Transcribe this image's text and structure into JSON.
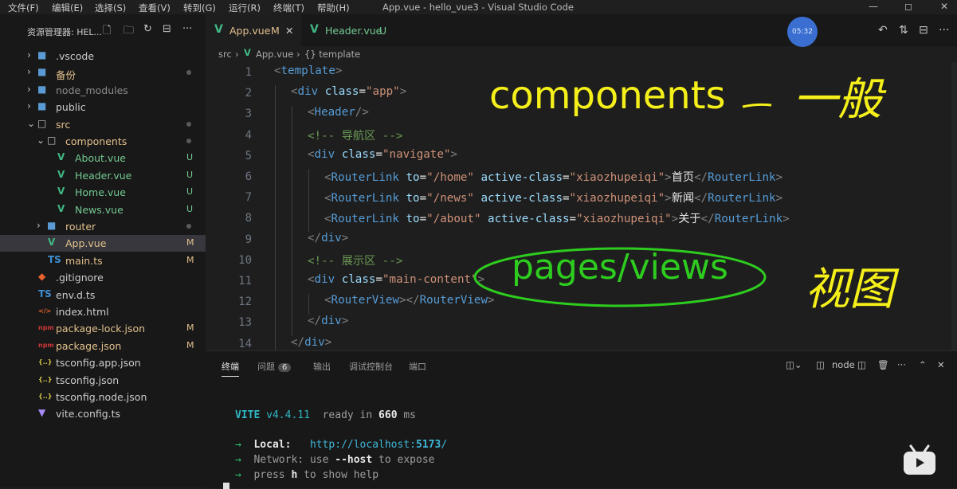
{
  "menubar": {
    "items": [
      "文件(F)",
      "编辑(E)",
      "选择(S)",
      "查看(V)",
      "转到(G)",
      "运行(R)",
      "终端(T)",
      "帮助(H)"
    ],
    "window_title": "App.vue - hello_vue3 - Visual Studio Code"
  },
  "sidebar": {
    "title": "资源管理器: HEL...",
    "actions": [
      "new-file-icon",
      "new-folder-icon",
      "refresh-icon",
      "collapse-icon",
      "more-icon"
    ],
    "items": [
      {
        "label": ".vscode",
        "kind": "folder",
        "indent": 0,
        "status": ""
      },
      {
        "label": "备份",
        "kind": "folder",
        "indent": 0,
        "status": "dot"
      },
      {
        "label": "node_modules",
        "kind": "folder",
        "indent": 0,
        "status": ""
      },
      {
        "label": "public",
        "kind": "folder",
        "indent": 0,
        "status": ""
      },
      {
        "label": "src",
        "kind": "folder-open",
        "indent": 0,
        "status": "dot"
      },
      {
        "label": "components",
        "kind": "folder-open",
        "indent": 1,
        "status": "dot"
      },
      {
        "label": "About.vue",
        "kind": "vue",
        "indent": 2,
        "status": "U"
      },
      {
        "label": "Header.vue",
        "kind": "vue",
        "indent": 2,
        "status": "U"
      },
      {
        "label": "Home.vue",
        "kind": "vue",
        "indent": 2,
        "status": "U"
      },
      {
        "label": "News.vue",
        "kind": "vue",
        "indent": 2,
        "status": "U"
      },
      {
        "label": "router",
        "kind": "folder",
        "indent": 1,
        "status": "dot"
      },
      {
        "label": "App.vue",
        "kind": "vue",
        "indent": 1,
        "status": "M"
      },
      {
        "label": "main.ts",
        "kind": "ts",
        "indent": 1,
        "status": "M"
      },
      {
        "label": ".gitignore",
        "kind": "git",
        "indent": 0,
        "status": ""
      },
      {
        "label": "env.d.ts",
        "kind": "ts",
        "indent": 0,
        "status": ""
      },
      {
        "label": "index.html",
        "kind": "html",
        "indent": 0,
        "status": ""
      },
      {
        "label": "package-lock.json",
        "kind": "npm",
        "indent": 0,
        "status": "M"
      },
      {
        "label": "package.json",
        "kind": "npm",
        "indent": 0,
        "status": "M"
      },
      {
        "label": "tsconfig.app.json",
        "kind": "json",
        "indent": 0,
        "status": ""
      },
      {
        "label": "tsconfig.json",
        "kind": "json",
        "indent": 0,
        "status": ""
      },
      {
        "label": "tsconfig.node.json",
        "kind": "json",
        "indent": 0,
        "status": ""
      },
      {
        "label": "vite.config.ts",
        "kind": "vite",
        "indent": 0,
        "status": ""
      }
    ],
    "selected": "App.vue"
  },
  "tabs": [
    {
      "label": "App.vue",
      "status": "M",
      "active": true
    },
    {
      "label": "Header.vue",
      "status": "U",
      "active": false
    }
  ],
  "timer": "05:32",
  "breadcrumb": [
    "src",
    "App.vue",
    "{} template"
  ],
  "editor": {
    "lines": [
      {
        "n": "1",
        "indent": 0,
        "tokens": [
          [
            "p",
            "<"
          ],
          [
            "t",
            "template"
          ],
          [
            "p",
            ">"
          ]
        ]
      },
      {
        "n": "2",
        "indent": 1,
        "tokens": [
          [
            "p",
            "<"
          ],
          [
            "t",
            "div"
          ],
          [
            "x",
            " "
          ],
          [
            "a",
            "class"
          ],
          [
            "x",
            "="
          ],
          [
            "s",
            "\"app\""
          ],
          [
            "p",
            ">"
          ]
        ]
      },
      {
        "n": "3",
        "indent": 2,
        "tokens": [
          [
            "p",
            "<"
          ],
          [
            "t",
            "Header"
          ],
          [
            "p",
            "/>"
          ]
        ]
      },
      {
        "n": "4",
        "indent": 2,
        "tokens": [
          [
            "c",
            "<!-- 导航区 -->"
          ]
        ]
      },
      {
        "n": "5",
        "indent": 2,
        "tokens": [
          [
            "p",
            "<"
          ],
          [
            "t",
            "div"
          ],
          [
            "x",
            " "
          ],
          [
            "a",
            "class"
          ],
          [
            "x",
            "="
          ],
          [
            "s",
            "\"navigate\""
          ],
          [
            "p",
            ">"
          ]
        ]
      },
      {
        "n": "6",
        "indent": 3,
        "tokens": [
          [
            "p",
            "<"
          ],
          [
            "t",
            "RouterLink"
          ],
          [
            "x",
            " "
          ],
          [
            "a",
            "to"
          ],
          [
            "x",
            "="
          ],
          [
            "s",
            "\"/home\""
          ],
          [
            "x",
            " "
          ],
          [
            "a",
            "active-class"
          ],
          [
            "x",
            "="
          ],
          [
            "s",
            "\"xiaozhupeiqi\""
          ],
          [
            "p",
            ">"
          ],
          [
            "x",
            "首页"
          ],
          [
            "p",
            "</"
          ],
          [
            "t",
            "RouterLink"
          ],
          [
            "p",
            ">"
          ]
        ]
      },
      {
        "n": "7",
        "indent": 3,
        "tokens": [
          [
            "p",
            "<"
          ],
          [
            "t",
            "RouterLink"
          ],
          [
            "x",
            " "
          ],
          [
            "a",
            "to"
          ],
          [
            "x",
            "="
          ],
          [
            "s",
            "\"/news\""
          ],
          [
            "x",
            " "
          ],
          [
            "a",
            "active-class"
          ],
          [
            "x",
            "="
          ],
          [
            "s",
            "\"xiaozhupeiqi\""
          ],
          [
            "p",
            ">"
          ],
          [
            "x",
            "新闻"
          ],
          [
            "p",
            "</"
          ],
          [
            "t",
            "RouterLink"
          ],
          [
            "p",
            ">"
          ]
        ]
      },
      {
        "n": "8",
        "indent": 3,
        "tokens": [
          [
            "p",
            "<"
          ],
          [
            "t",
            "RouterLink"
          ],
          [
            "x",
            " "
          ],
          [
            "a",
            "to"
          ],
          [
            "x",
            "="
          ],
          [
            "s",
            "\"/about\""
          ],
          [
            "x",
            " "
          ],
          [
            "a",
            "active-class"
          ],
          [
            "x",
            "="
          ],
          [
            "s",
            "\"xiaozhupeiqi\""
          ],
          [
            "p",
            ">"
          ],
          [
            "x",
            "关于"
          ],
          [
            "p",
            "</"
          ],
          [
            "t",
            "RouterLink"
          ],
          [
            "p",
            ">"
          ]
        ]
      },
      {
        "n": "9",
        "indent": 2,
        "tokens": [
          [
            "p",
            "</"
          ],
          [
            "t",
            "div"
          ],
          [
            "p",
            ">"
          ]
        ]
      },
      {
        "n": "10",
        "indent": 2,
        "tokens": [
          [
            "c",
            "<!-- 展示区 -->"
          ]
        ]
      },
      {
        "n": "11",
        "indent": 2,
        "tokens": [
          [
            "p",
            "<"
          ],
          [
            "t",
            "div"
          ],
          [
            "x",
            " "
          ],
          [
            "a",
            "class"
          ],
          [
            "x",
            "="
          ],
          [
            "s",
            "\"main-content\""
          ],
          [
            "p",
            ">"
          ]
        ]
      },
      {
        "n": "12",
        "indent": 3,
        "tokens": [
          [
            "p",
            "<"
          ],
          [
            "t",
            "RouterView"
          ],
          [
            "p",
            "></"
          ],
          [
            "t",
            "RouterView"
          ],
          [
            "p",
            ">"
          ]
        ]
      },
      {
        "n": "13",
        "indent": 2,
        "tokens": [
          [
            "p",
            "</"
          ],
          [
            "t",
            "div"
          ],
          [
            "p",
            ">"
          ]
        ]
      },
      {
        "n": "14",
        "indent": 1,
        "tokens": [
          [
            "p",
            "</"
          ],
          [
            "t",
            "div"
          ],
          [
            "p",
            ">"
          ]
        ]
      }
    ]
  },
  "annotations": {
    "components": "components",
    "components_note": "一般",
    "pages": "pages/views",
    "pages_note": "视图"
  },
  "panel": {
    "tabs": [
      "终端",
      "问题",
      "输出",
      "调试控制台",
      "端口"
    ],
    "problems_count": "6",
    "shell": "node",
    "terminal": {
      "vite_name": "VITE",
      "vite_version": "v4.4.11",
      "ready_text": "ready in",
      "ready_ms": "660",
      "ready_unit": "ms",
      "local_label": "Local:",
      "local_url_prefix": "http://localhost:",
      "local_port": "5173",
      "local_url_suffix": "/",
      "network_label": "Network:",
      "network_use": "use",
      "network_flag": "--host",
      "network_rest": "to expose",
      "help_press": "press",
      "help_key": "h",
      "help_rest": "to show help"
    }
  },
  "colors": {
    "vue_green": "#41b883",
    "annotation_yellow": "#f5ef1a",
    "annotation_green": "#2ecc1f",
    "accent": "#3a6fd1"
  }
}
